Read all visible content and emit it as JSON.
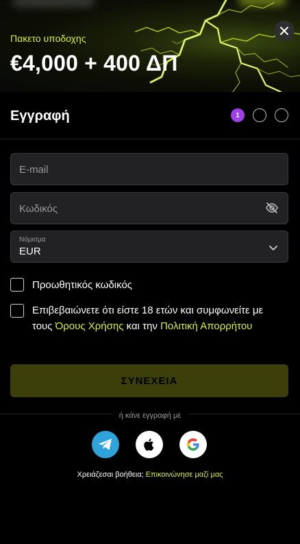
{
  "promo": {
    "label": "Πακετο υποδοχης",
    "amount": "€4,000 + 400 ΔΠ"
  },
  "header": {
    "title": "Εγγραφή",
    "steps": {
      "current": "1",
      "total": 3
    }
  },
  "form": {
    "email_placeholder": "E-mail",
    "password_placeholder": "Κωδικός",
    "currency_label": "Νόμισμα",
    "currency_value": "EUR",
    "promo_code_label": "Προωθητικός κωδικός",
    "terms": {
      "text_before": "Επιβεβαιώνετε ότι είστε 18 ετών και συμφωνείτε με τους ",
      "terms_link": "Όρους Χρήσης",
      "text_middle": " και την ",
      "privacy_link": "Πολιτική Απορρήτου"
    },
    "continue_label": "ΣΥΝΕΧΕΙΑ"
  },
  "social": {
    "divider_text": "ή κάνε εγγραφή με",
    "providers": [
      "telegram-icon",
      "apple-icon",
      "google-icon"
    ]
  },
  "help": {
    "text": "Χρειάζεσαι βοήθεια; ",
    "link": "Επικοινώνησε μαζί μας"
  },
  "colors": {
    "accent": "#d7f238",
    "step_active": "#a040e6",
    "continue_bg": "#3c3f0a",
    "telegram": "#2fa3da"
  }
}
